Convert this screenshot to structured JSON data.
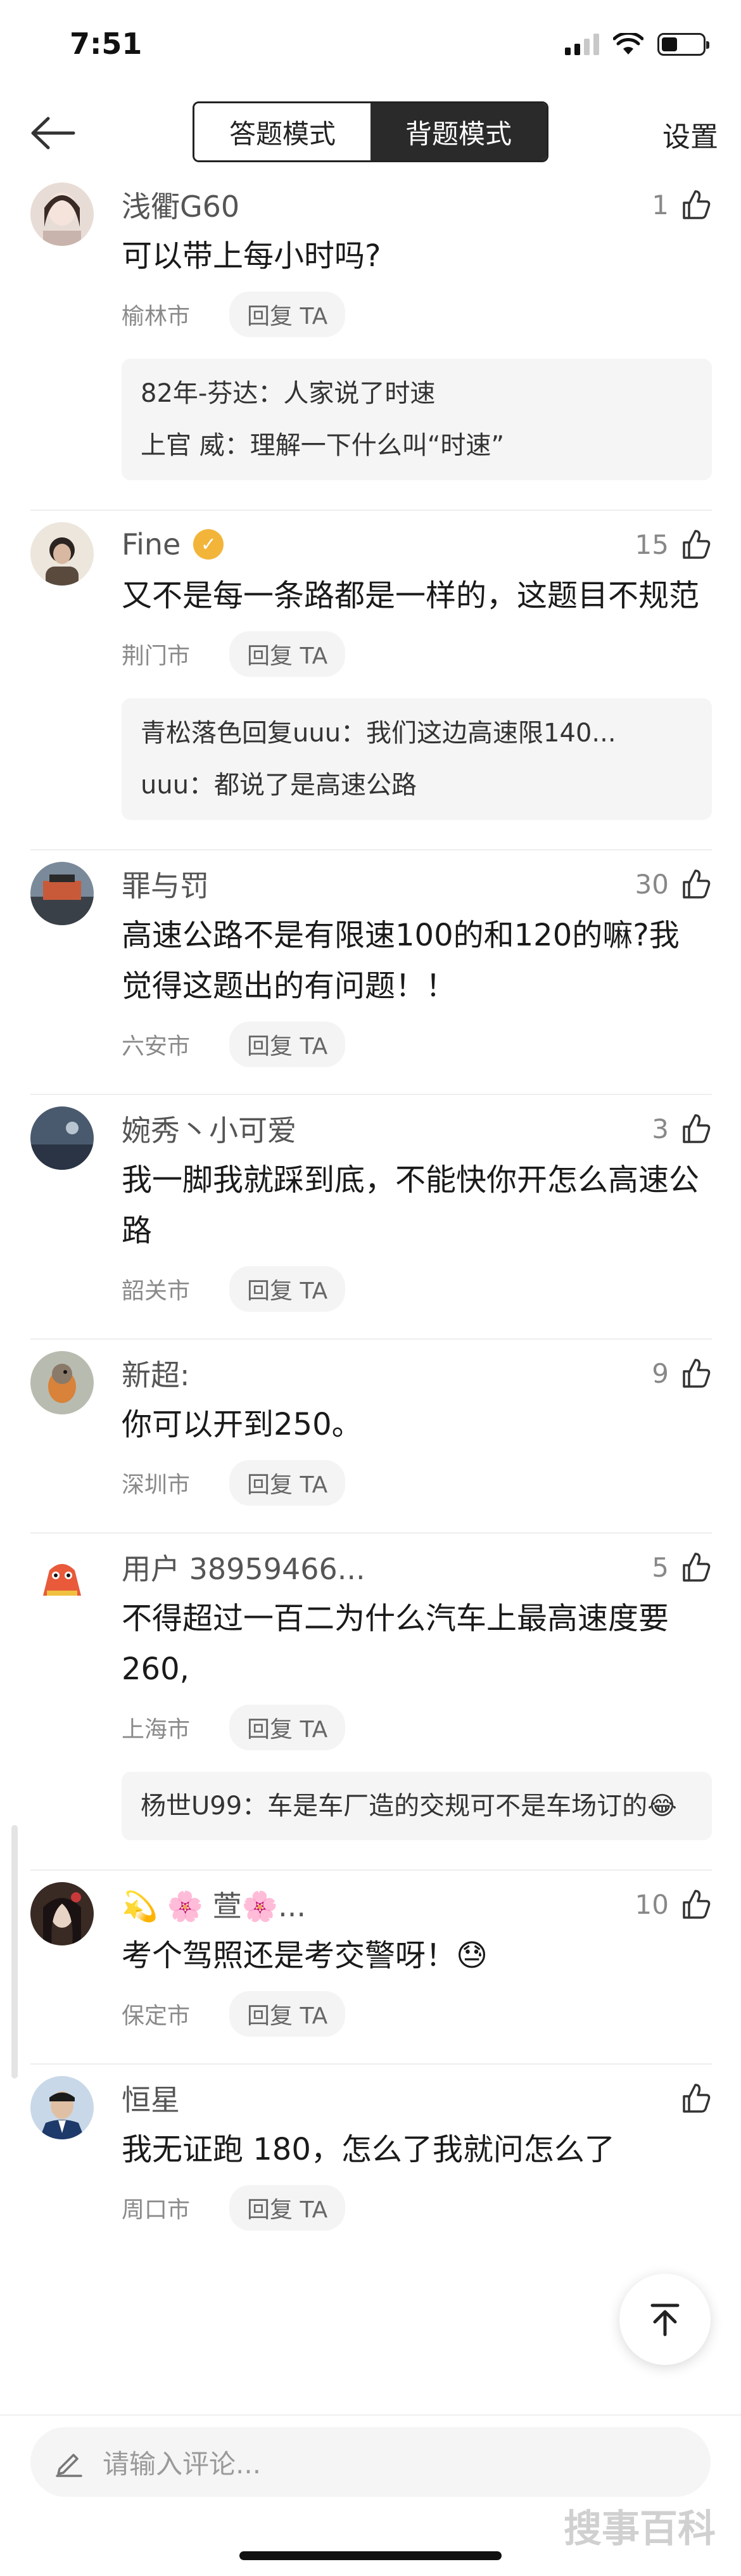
{
  "status_bar": {
    "time": "7:51"
  },
  "header": {
    "modes": [
      "答题模式",
      "背题模式"
    ],
    "active_mode": "背题模式",
    "settings_label": "设置"
  },
  "comments": [
    {
      "username": "浅衢G60",
      "likes": "1",
      "content": "可以带上每小时吗?",
      "city": "榆林市",
      "reply_label": "回复 TA",
      "replies": [
        "82年-芬达：人家说了时速",
        "上官 威：理解一下什么叫“时速”"
      ]
    },
    {
      "username": "Fine",
      "likes": "15",
      "content": "又不是每一条路都是一样的，这题目不规范",
      "city": "荆门市",
      "reply_label": "回复 TA",
      "replies": [
        "青松落色回复uuu：我们这边高速限140...",
        "uuu：都说了是高速公路"
      ]
    },
    {
      "username": "罪与罚",
      "likes": "30",
      "content": "高速公路不是有限速100的和120的嘛?我觉得这题出的有问题！！",
      "city": "六安市",
      "reply_label": "回复 TA",
      "replies": []
    },
    {
      "username": "婉秀丶小可爱",
      "likes": "3",
      "content": "我一脚我就踩到底，不能快你开怎么高速公路",
      "city": "韶关市",
      "reply_label": "回复 TA",
      "replies": []
    },
    {
      "username": "新超:",
      "likes": "9",
      "content": "你可以开到250。",
      "city": "深圳市",
      "reply_label": "回复 TA",
      "replies": []
    },
    {
      "username": "用户 38959466...",
      "likes": "5",
      "content": "不得超过一百二为什么汽车上最高速度要260,",
      "city": "上海市",
      "reply_label": "回复 TA",
      "replies": [
        "杨世U99：车是车厂造的交规可不是车场订的😂"
      ]
    },
    {
      "username": "💫 🌸  萱🌸...",
      "likes": "10",
      "content": "考个驾照还是考交警呀！😓",
      "city": "保定市",
      "reply_label": "回复 TA",
      "replies": []
    },
    {
      "username": "恒星",
      "likes": "",
      "content": "我无证跑 180，怎么了我就问怎么了",
      "city": "周口市",
      "reply_label": "回复 TA",
      "replies": []
    }
  ],
  "input": {
    "placeholder": "请输入评论..."
  },
  "watermark": "搜事百科",
  "colors": {
    "accent_badge": "#f2b53a",
    "active_tab": "#2a2a2a"
  }
}
